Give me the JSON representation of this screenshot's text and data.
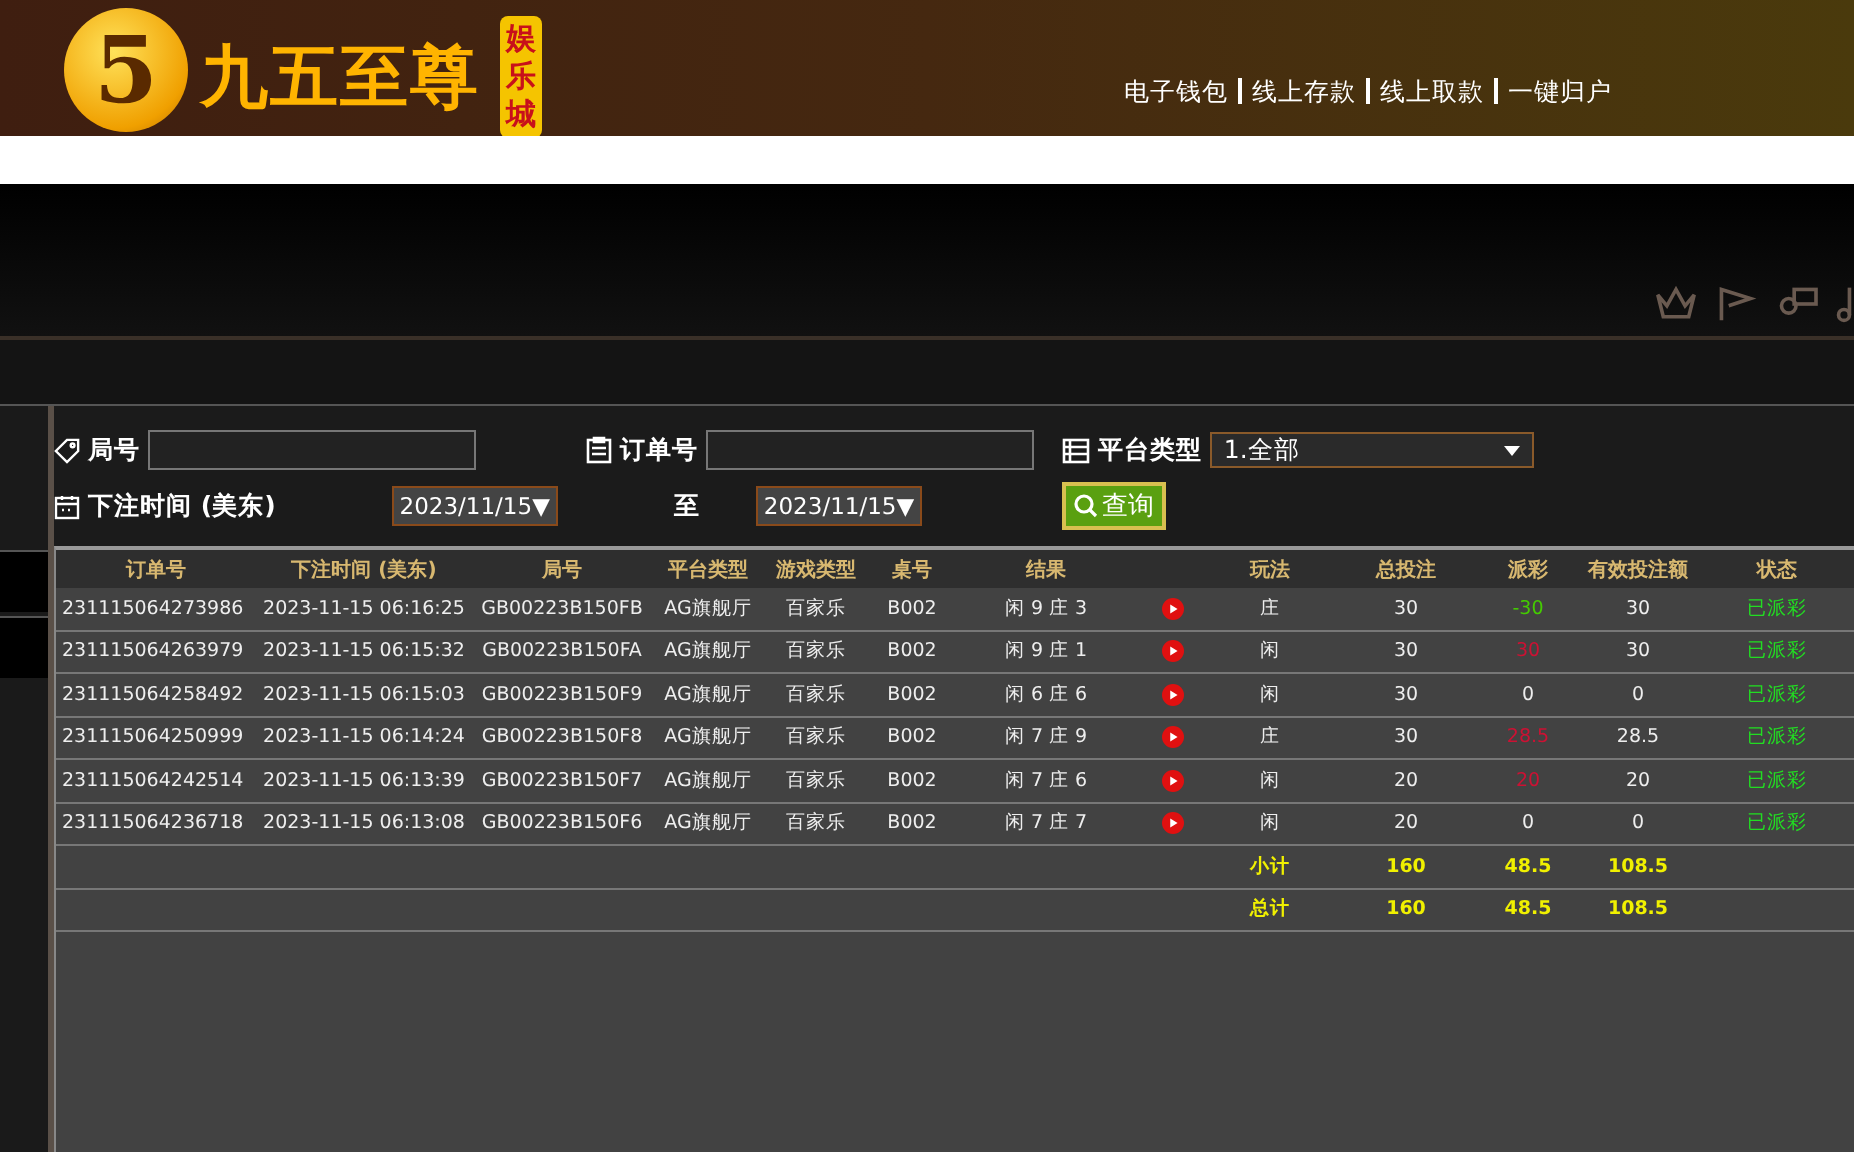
{
  "header": {
    "logo_mark": "5",
    "logo_title": "九五至尊",
    "logo_badge": "娱乐城",
    "links": [
      "电子钱包",
      "线上存款",
      "线上取款",
      "一键归户"
    ]
  },
  "filters": {
    "round_label": "局号",
    "order_label": "订单号",
    "platform_label": "平台类型",
    "platform_value": "1.全部",
    "time_label": "下注时间 (美东)",
    "date_from": "2023/11/15▼",
    "to_label": "至",
    "date_to": "2023/11/15▼",
    "search_button": "查询"
  },
  "table": {
    "columns": [
      "订单号",
      "下注时间 (美东)",
      "局号",
      "平台类型",
      "游戏类型",
      "桌号",
      "结果",
      "玩法",
      "总投注",
      "派彩",
      "有效投注额",
      "状态"
    ],
    "rows": [
      {
        "order": "231115064273986",
        "time": "2023-11-15 06:16:25",
        "round": "GB00223B150FB",
        "platform": "AG旗舰厅",
        "game": "百家乐",
        "table": "B002",
        "result": "闲 9 庄 3",
        "bet": "庄",
        "total": "30",
        "payout": {
          "text": "-30",
          "color": "#44cc00"
        },
        "valid": "30",
        "status": "已派彩"
      },
      {
        "order": "231115064263979",
        "time": "2023-11-15 06:15:32",
        "round": "GB00223B150FA",
        "platform": "AG旗舰厅",
        "game": "百家乐",
        "table": "B002",
        "result": "闲 9 庄 1",
        "bet": "闲",
        "total": "30",
        "payout": {
          "text": "30",
          "color": "#cc1133"
        },
        "valid": "30",
        "status": "已派彩"
      },
      {
        "order": "231115064258492",
        "time": "2023-11-15 06:15:03",
        "round": "GB00223B150F9",
        "platform": "AG旗舰厅",
        "game": "百家乐",
        "table": "B002",
        "result": "闲 6 庄 6",
        "bet": "闲",
        "total": "30",
        "payout": {
          "text": "0",
          "color": "#eeeeee"
        },
        "valid": "0",
        "status": "已派彩"
      },
      {
        "order": "231115064250999",
        "time": "2023-11-15 06:14:24",
        "round": "GB00223B150F8",
        "platform": "AG旗舰厅",
        "game": "百家乐",
        "table": "B002",
        "result": "闲 7 庄 9",
        "bet": "庄",
        "total": "30",
        "payout": {
          "text": "28.5",
          "color": "#cc1133"
        },
        "valid": "28.5",
        "status": "已派彩"
      },
      {
        "order": "231115064242514",
        "time": "2023-11-15 06:13:39",
        "round": "GB00223B150F7",
        "platform": "AG旗舰厅",
        "game": "百家乐",
        "table": "B002",
        "result": "闲 7 庄 6",
        "bet": "闲",
        "total": "20",
        "payout": {
          "text": "20",
          "color": "#cc1133"
        },
        "valid": "20",
        "status": "已派彩"
      },
      {
        "order": "231115064236718",
        "time": "2023-11-15 06:13:08",
        "round": "GB00223B150F6",
        "platform": "AG旗舰厅",
        "game": "百家乐",
        "table": "B002",
        "result": "闲 7 庄 7",
        "bet": "闲",
        "total": "20",
        "payout": {
          "text": "0",
          "color": "#eeeeee"
        },
        "valid": "0",
        "status": "已派彩"
      }
    ],
    "summary": [
      {
        "label": "小计",
        "total": "160",
        "payout": "48.5",
        "valid": "108.5"
      },
      {
        "label": "总计",
        "total": "160",
        "payout": "48.5",
        "valid": "108.5"
      }
    ]
  }
}
